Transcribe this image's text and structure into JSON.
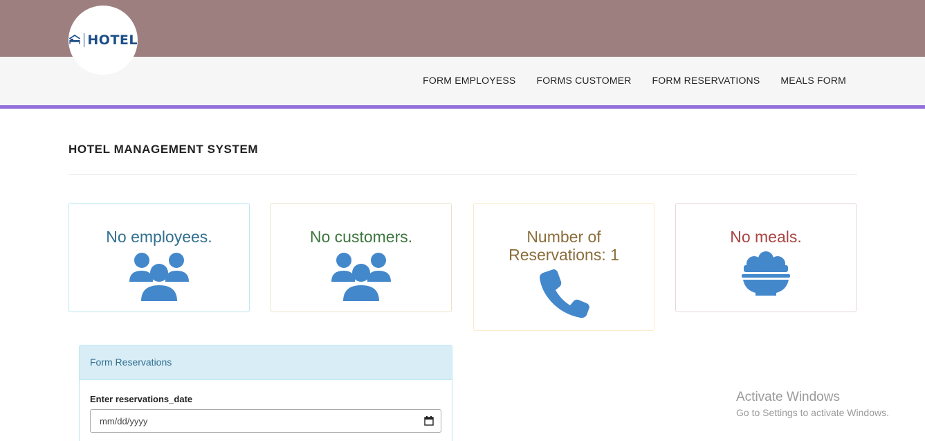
{
  "header": {
    "logo_text": "HOTEL",
    "nav": [
      {
        "label": "FORM EMPLOYESS"
      },
      {
        "label": "FORMS CUSTOMER"
      },
      {
        "label": "FORM RESERVATIONS"
      },
      {
        "label": "MEALS FORM"
      }
    ]
  },
  "main": {
    "title": "HOTEL MANAGEMENT SYSTEM",
    "cards": [
      {
        "label": "No employees.",
        "icon": "users-icon",
        "color": "#31708f",
        "border": "#bce8f1"
      },
      {
        "label": "No customers.",
        "icon": "users-icon",
        "color": "#3c763d",
        "border": "#e8e2c8"
      },
      {
        "label": "Number of Reservations: 1",
        "icon": "phone-icon",
        "color": "#8a6d3b",
        "border": "#faebcc"
      },
      {
        "label": "No meals.",
        "icon": "bowl-icon",
        "color": "#a94442",
        "border": "#e6d6d6"
      }
    ],
    "icon_color": "#4488cc"
  },
  "form": {
    "title": "Form Reservations",
    "date_label": "Enter reservations_date",
    "date_placeholder": "mm/dd/yyyy"
  },
  "watermark": {
    "line1": "Activate Windows",
    "line2": "Go to Settings to activate Windows."
  }
}
